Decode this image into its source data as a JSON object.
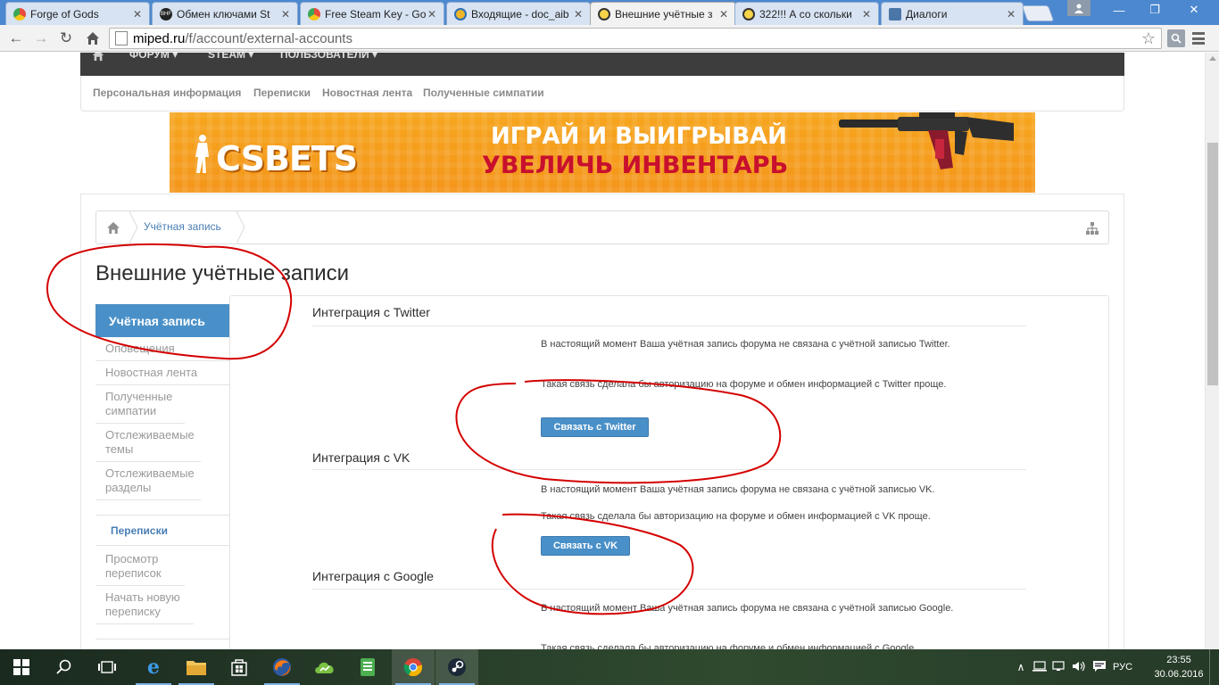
{
  "browser": {
    "tabs": [
      {
        "label": "Forge of Gods",
        "active": false
      },
      {
        "label": "Обмен ключами St",
        "active": false
      },
      {
        "label": "Free Steam Key - Go",
        "active": false
      },
      {
        "label": "Входящие - doc_aib",
        "active": false
      },
      {
        "label": "Внешние учётные з",
        "active": true
      },
      {
        "label": "322!!! А со скольки",
        "active": false
      },
      {
        "label": "Диалоги",
        "active": false
      }
    ],
    "url_domain": "miped.ru",
    "url_path": "/f/account/external-accounts"
  },
  "site": {
    "topnav": [
      "ФОРУМ ▾",
      "STEAM ▾",
      "ПОЛЬЗОВАТЕЛИ ▾"
    ],
    "subnav": [
      "Персональная информация",
      "Переписки",
      "Новостная лента",
      "Полученные симпатии"
    ],
    "banner": {
      "logo": "CSBETS",
      "line1": "ИГРАЙ И ВЫИГРЫВАЙ",
      "line2": "УВЕЛИЧЬ ИНВЕНТАРЬ"
    },
    "breadcrumb": [
      "Учётная запись"
    ],
    "page_title": "Внешние учётные записи"
  },
  "sidebar": {
    "active": "Учётная запись",
    "items": [
      "Оповещения",
      "Новостная лента",
      "Полученные симпатии",
      "Отслеживаемые темы",
      "Отслеживаемые разделы"
    ],
    "group2_title": "Переписки",
    "group2_items": [
      "Просмотр переписок",
      "Начать новую переписку"
    ]
  },
  "main": {
    "twitter": {
      "title": "Интеграция с Twitter",
      "status": "В настоящий момент Ваша учётная запись форума не связана с учётной записью Twitter.",
      "benefit": "Такая связь сделала бы авторизацию на форуме и обмен информацией с Twitter проще.",
      "button": "Связать с Twitter"
    },
    "vk": {
      "title": "Интеграция с VK",
      "status": "В настоящий момент Ваша учётная запись форума не связана с учётной записью VK.",
      "benefit": "Такая связь сделала бы авторизацию на форуме и обмен информацией с VK проще.",
      "button": "Связать с VK"
    },
    "google": {
      "title": "Интеграция с Google",
      "status": "В настоящий момент Ваша учётная запись форума не связана с учётной записью Google.",
      "benefit": "Такая связь сделала бы авторизацию на форуме и обмен информацией с Google"
    }
  },
  "taskbar": {
    "language": "РУС",
    "time": "23:55",
    "date": "30.06.2016"
  },
  "colors": {
    "accent": "#4a90c8",
    "link": "#4a7fb5",
    "annotation": "#d40000",
    "chrome_frame": "#4c88cf"
  }
}
